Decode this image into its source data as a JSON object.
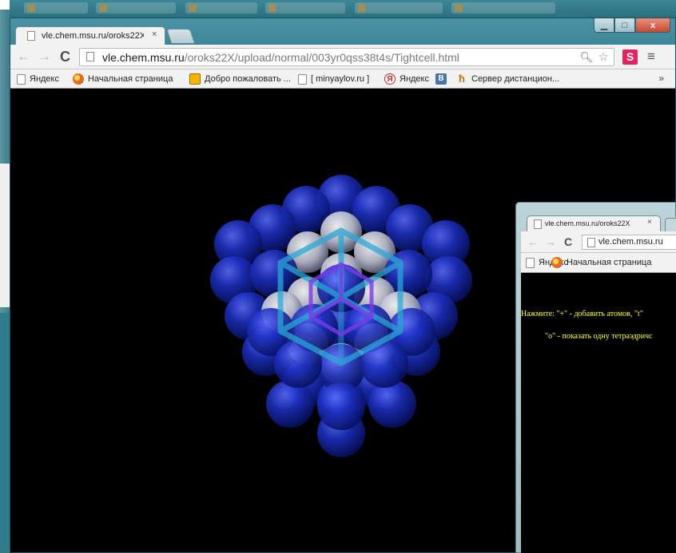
{
  "main_window": {
    "tab_title": "vle.chem.msu.ru/oroks22X",
    "tab_close": "×",
    "url_host": "vle.chem.msu.ru",
    "url_path": "/oroks22X/upload/normal/003yr0qss38t4s/Tightcell.html",
    "ext_label": "S",
    "bookmarks": [
      {
        "label": "Яндекс",
        "icon": "document-icon"
      },
      {
        "label": "Начальная страница",
        "icon": "firefox-icon"
      },
      {
        "label": "Добро пожаловать ...",
        "icon": "square-logo-icon"
      },
      {
        "label": "[ minyaylov.ru ]",
        "icon": "document-icon"
      },
      {
        "label": "Яндекс",
        "icon": "yandex-icon",
        "glyph": "Я"
      },
      {
        "label": "",
        "icon": "vk-icon",
        "glyph": "В"
      },
      {
        "label": "Сервер дистанцион...",
        "icon": "msu-icon",
        "glyph": "ħ"
      }
    ],
    "bookmarks_more": "»",
    "window_buttons": {
      "minimize": "▁",
      "maximize": "□",
      "close": "x"
    }
  },
  "second_window": {
    "tab_title": "vle.chem.msu.ru/oroks22X",
    "tab_close": "×",
    "url": "vle.chem.msu.ru",
    "bookmarks": [
      {
        "label": "Яндекс",
        "icon": "document-icon"
      },
      {
        "label": "Начальная страница",
        "icon": "firefox-icon"
      }
    ],
    "instructions": [
      "Нажмите: \"+\" - добавить атомов, \"t\"",
      "\"o\" - показать одну тетраэдричс"
    ]
  },
  "colors": {
    "sphere_blue": "#1b2fb0",
    "sphere_grey": "#c9cce0",
    "cube_outer": "#2aa7d6",
    "cube_inner": "#7a3ae8",
    "instruction_text": "#ffff33"
  }
}
